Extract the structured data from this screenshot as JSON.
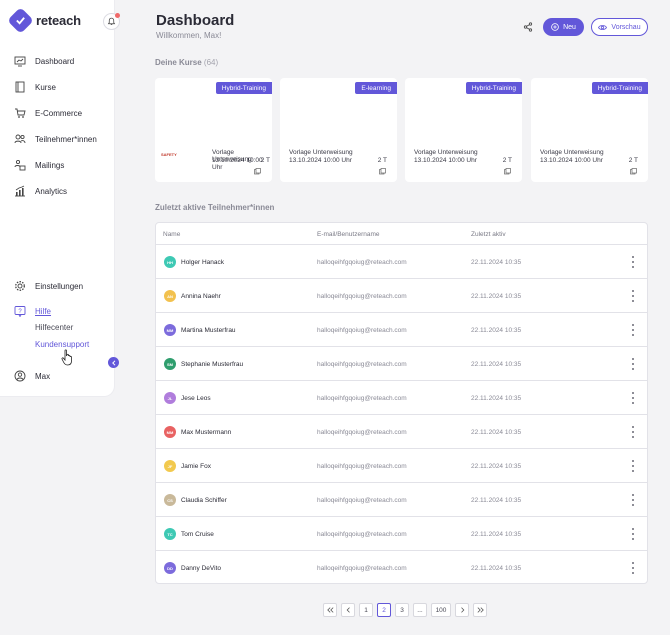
{
  "app": {
    "name": "reteach"
  },
  "sidebar": {
    "nav": [
      {
        "label": "Dashboard",
        "icon": "dashboard-icon"
      },
      {
        "label": "Kurse",
        "icon": "book-icon"
      },
      {
        "label": "E-Commerce",
        "icon": "cart-icon"
      },
      {
        "label": "Teilnehmer*innen",
        "icon": "users-icon"
      },
      {
        "label": "Mailings",
        "icon": "mail-users-icon"
      },
      {
        "label": "Analytics",
        "icon": "analytics-icon"
      }
    ],
    "settings": "Einstellungen",
    "help": "Hilfe",
    "help_center": "Hilfecenter",
    "support": "Kundensupport",
    "user": "Max"
  },
  "header": {
    "title": "Dashboard",
    "subtitle": "Willkommen, Max!",
    "new_label": "Neu",
    "preview_label": "Vorschau"
  },
  "courses": {
    "title": "Deine Kurse",
    "count": "(64)",
    "items": [
      {
        "badge": "Hybrid-Training",
        "name": "Vorlage Unterweisung",
        "date": "13.10.2024 10:00 Uhr",
        "duration": "2 T",
        "thumb": "SAFETY"
      },
      {
        "badge": "E-learning",
        "name": "Vorlage Unterweisung",
        "date": "13.10.2024 10:00 Uhr",
        "duration": "2 T"
      },
      {
        "badge": "Hybrid-Training",
        "name": "Vorlage Unterweisung",
        "date": "13.10.2024 10:00 Uhr",
        "duration": "2 T"
      },
      {
        "badge": "Hybrid-Training",
        "name": "Vorlage Unterweisung",
        "date": "13.10.2024 10:00 Uhr",
        "duration": "2 T"
      }
    ]
  },
  "participants": {
    "title": "Zuletzt aktive Teilnehmer*innen",
    "columns": [
      "Name",
      "E-mail/Benutzername",
      "Zuletzt aktiv"
    ],
    "rows": [
      {
        "initials": "HH",
        "name": "Holger Hanack",
        "email": "halloqeihfgqoiug@reteach.com",
        "date": "22.11.2024 10:35",
        "color": "#3ec9b4"
      },
      {
        "initials": "AN",
        "name": "Annina Naehr",
        "email": "halloqeihfgqoiug@reteach.com",
        "date": "22.11.2024 10:35",
        "color": "#f2c14e"
      },
      {
        "initials": "MM",
        "name": "Martina Musterfrau",
        "email": "halloqeihfgqoiug@reteach.com",
        "date": "22.11.2024 10:35",
        "color": "#7c6bdc"
      },
      {
        "initials": "SM",
        "name": "Stephanie Musterfrau",
        "email": "halloqeihfgqoiug@reteach.com",
        "date": "22.11.2024 10:35",
        "color": "#2f9e6e"
      },
      {
        "initials": "JL",
        "name": "Jese Leos",
        "email": "halloqeihfgqoiug@reteach.com",
        "date": "22.11.2024 10:35",
        "color": "#b07ddc"
      },
      {
        "initials": "MM",
        "name": "Max Mustermann",
        "email": "halloqeihfgqoiug@reteach.com",
        "date": "22.11.2024 10:35",
        "color": "#e86262"
      },
      {
        "initials": "JF",
        "name": "Jamie Fox",
        "email": "halloqeihfgqoiug@reteach.com",
        "date": "22.11.2024 10:35",
        "color": "#f2c94e"
      },
      {
        "initials": "CS",
        "name": "Claudia Schiffer",
        "email": "halloqeihfgqoiug@reteach.com",
        "date": "22.11.2024 10:35",
        "color": "#c9b99a"
      },
      {
        "initials": "TC",
        "name": "Tom Cruise",
        "email": "halloqeihfgqoiug@reteach.com",
        "date": "22.11.2024 10:35",
        "color": "#3ec9b4"
      },
      {
        "initials": "DD",
        "name": "Danny DeVito",
        "email": "halloqeihfgqoiug@reteach.com",
        "date": "22.11.2024 10:35",
        "color": "#7c6bdc"
      }
    ]
  },
  "pagination": {
    "pages": [
      "1",
      "2",
      "3",
      "...",
      "100"
    ],
    "current": "2"
  },
  "colors": {
    "accent": "#6257d9"
  }
}
